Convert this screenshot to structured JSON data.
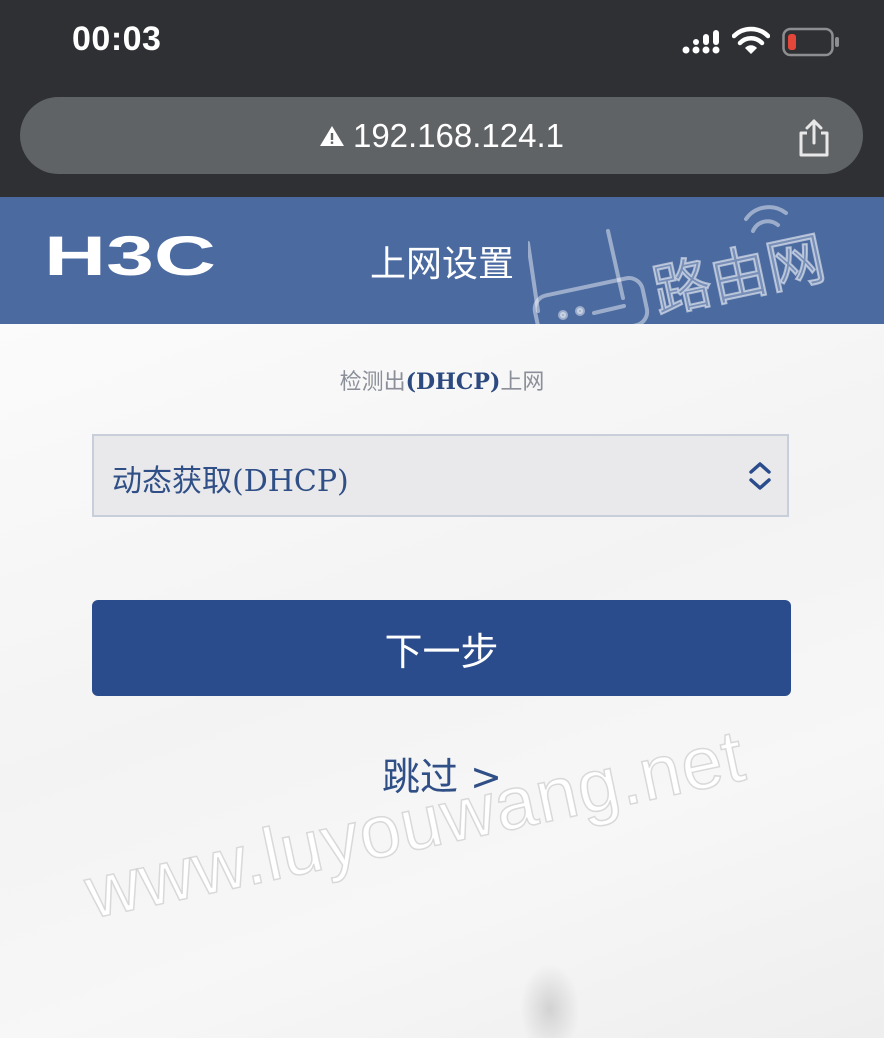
{
  "status_bar": {
    "time": "00:03",
    "icons": [
      "cellular-signal-icon",
      "wifi-icon",
      "battery-low-icon"
    ],
    "battery_color": "#e5463a"
  },
  "browser": {
    "url": "192.168.124.1",
    "icons": [
      "warning-icon",
      "share-icon"
    ]
  },
  "header": {
    "logo_text": "H3C",
    "title": "上网设置",
    "watermark_brand": "路由网",
    "bg_color": "#4b6aa0"
  },
  "main": {
    "detect_prefix": "检测出",
    "detect_mode": "(DHCP)",
    "detect_suffix": "上网",
    "connection_type": {
      "selected": "动态获取(DHCP)"
    },
    "next_button": "下一步",
    "skip_link": "跳过 >",
    "watermark": "www.luyouwang.net",
    "accent_color": "#2b4c8c"
  }
}
